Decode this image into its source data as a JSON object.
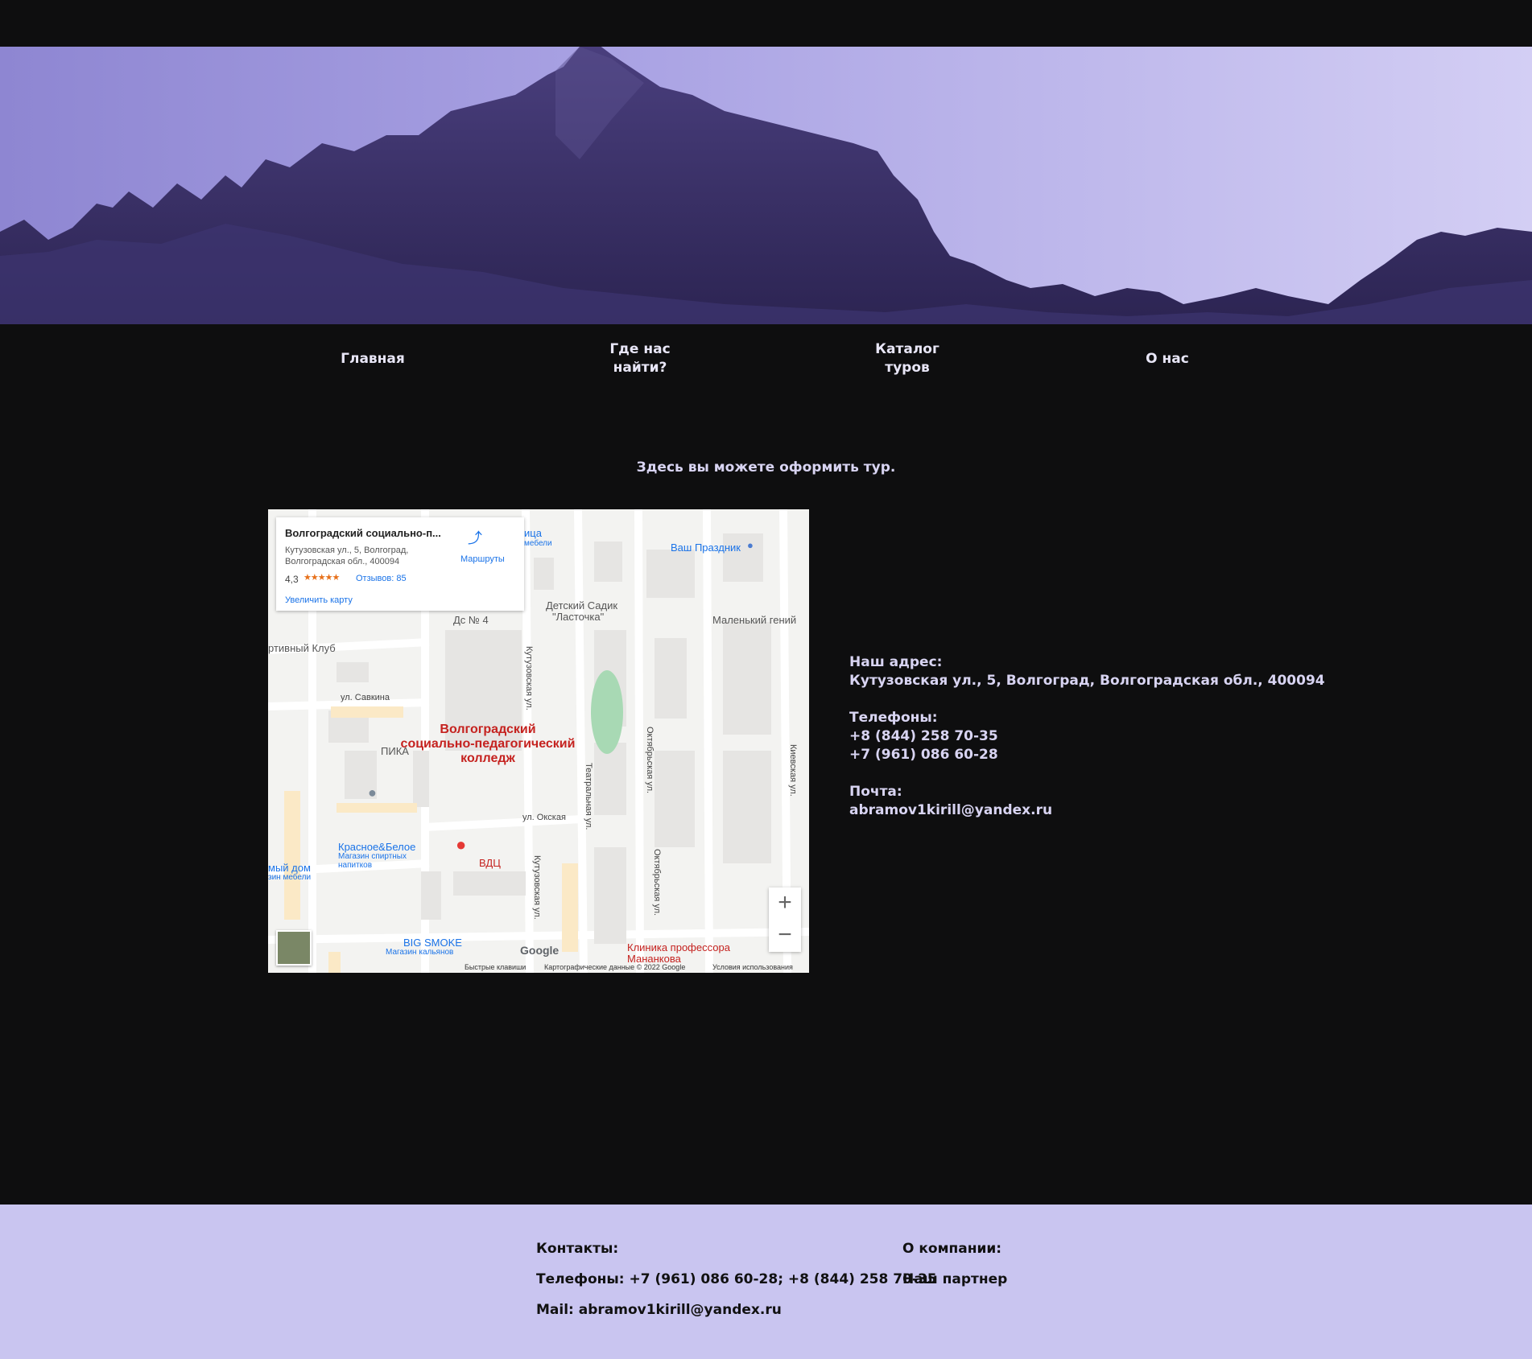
{
  "nav": {
    "home": "Главная",
    "where_line1": "Где нас",
    "where_line2": "найти?",
    "catalog_line1": "Каталог",
    "catalog_line2": "туров",
    "about": "О нас"
  },
  "tagline": "Здесь вы можете оформить тур.",
  "map": {
    "place_title": "Волгоградский социально-п...",
    "place_address_line1": "Кутузовская ул., 5, Волгоград,",
    "place_address_line2": "Волгоградская обл., 400094",
    "rating": "4,3",
    "stars": 4.3,
    "reviews": "Отзывов: 85",
    "directions": "Маршруты",
    "enlarge": "Увеличить карту",
    "center_label_1": "Волгоградский",
    "center_label_2": "социально-педагогический",
    "center_label_3": "колледж",
    "labels": {
      "party": "Ваш Праздник",
      "kindergarten_1": "Детский Садик",
      "kindergarten_2": "\"Ласточка\"",
      "ds4": "Дс № 4",
      "genius": "Маленький гений",
      "sport_club": "ртивный Клуб",
      "savkina": "ул. Савкина",
      "pika": "ПИКА",
      "oksk": "ул. Окская",
      "kb_1": "Красное&Белое",
      "kb_2": "Магазин спиртных",
      "kb_3": "напитков",
      "vdc": "ВДЦ",
      "furniture_1": "мый дом",
      "furniture_2": "зин мебели",
      "bigsmoke_1": "BIG SMOKE",
      "bigsmoke_2": "Магазин кальянов",
      "clinic_1": "Клиника профессора",
      "clinic_2": "Мананкова",
      "pizza": "ица",
      "mebeli": "мебели",
      "kutuz_1": "Кутузовская ул.",
      "kutuz_2": "Кутузовская ул.",
      "teatr": "Театральная ул.",
      "okt_1": "Октябрьская ул.",
      "okt_2": "Октябрьская ул.",
      "kiev": "Киевская ул."
    },
    "zoom_in": "+",
    "zoom_out": "−",
    "google": "Google",
    "shortcuts": "Быстрые клавиши",
    "map_data": "Картографические данные © 2022 Google",
    "terms": "Условия использования"
  },
  "contacts": {
    "address_label": "Наш адрес:",
    "address": "Кутузовская ул., 5, Волгоград, Волгоградская обл., 400094",
    "phones_label": "Телефоны:",
    "phone1": "+8 (844) 258 70-35",
    "phone2": "+7 (961) 086 60-28",
    "mail_label": "Почта:",
    "mail": "abramov1kirill@yandex.ru"
  },
  "footer": {
    "contacts_title": "Контакты:",
    "phones": "Телефоны: +7 (961) 086 60-28; +8 (844) 258 70-35",
    "mail": "Mail: abramov1kirill@yandex.ru",
    "company_title": "О компании:",
    "partner": "Наш партнер"
  },
  "colors": {
    "background": "#0e0e0f",
    "accent": "#c9c5f0",
    "text_light": "#d8d4f2"
  }
}
